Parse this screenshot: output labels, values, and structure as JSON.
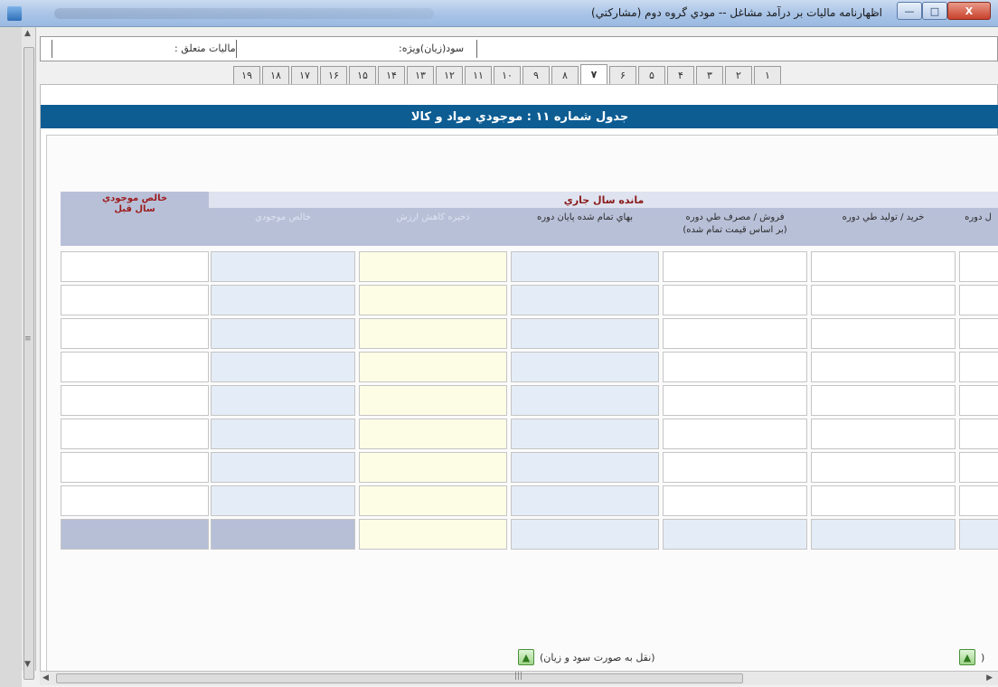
{
  "window": {
    "title": "اظهارنامه ماليات بر درآمد مشاغل -- مودي گروه دوم (مشاركتي)",
    "minimize": "—",
    "maximize": "□",
    "close": "X"
  },
  "header_fields": {
    "profit_loss_label": "سود(زيان)ويژه:",
    "tax_due_label": "ماليات متعلق :"
  },
  "tabs": [
    "١",
    "٢",
    "٣",
    "۴",
    "۵",
    "۶",
    "٧",
    "٨",
    "٩",
    "١٠",
    "١١",
    "١٢",
    "١٣",
    "١۴",
    "١۵",
    "١۶",
    "١٧",
    "١٨",
    "١٩"
  ],
  "active_tab": "٧",
  "table": {
    "title": "جدول شماره ١١ : موجودي مواد و كالا",
    "group_header": "مانده سال جاري",
    "prev_year_header": "خالص موجودي\nسال قبل",
    "columns": {
      "net_inventory": "خالص موجودي",
      "impairment": "ذخيره كاهش ارزش",
      "cost_end": "بهاي تمام شده پايان دوره",
      "sales": "فروش / مصرف طي دوره\n(بر اساس قيمت تمام شده)",
      "purchase": "خريد / توليد طي دوره",
      "start": "ل دوره"
    }
  },
  "actions": {
    "transfer_pl": "(نقل به صورت سود و زيان)",
    "transfer_right": "("
  },
  "colors": {
    "title_bar": "#0d5d93",
    "group_text": "#8b1a1a",
    "cell_blue": "#e4ecf7",
    "cell_yellow": "#fdfde6",
    "cell_gray": "#b7bfd7"
  }
}
